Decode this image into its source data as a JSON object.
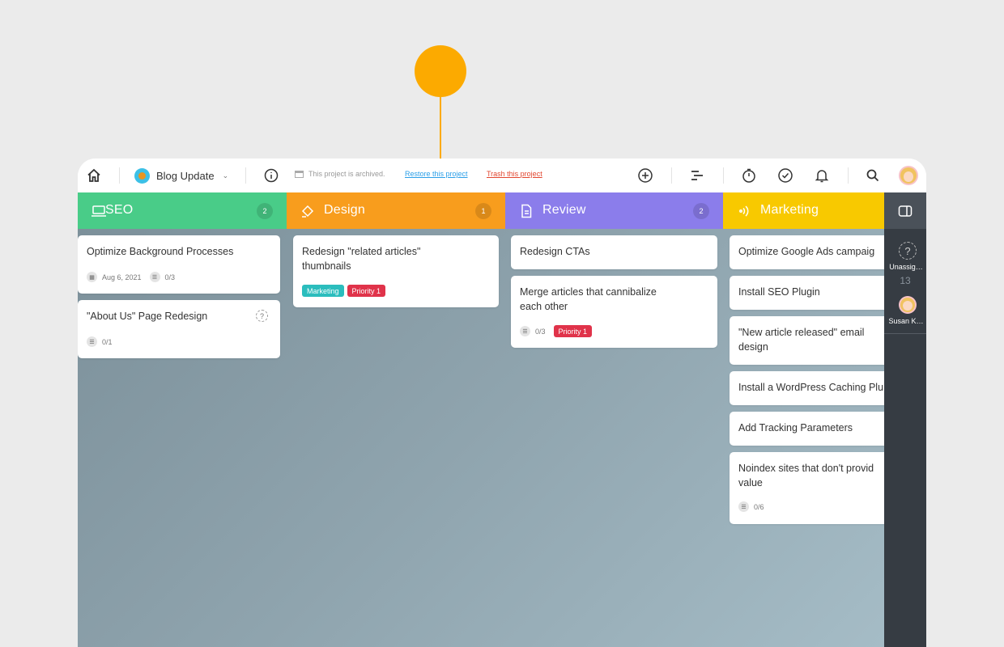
{
  "topbar": {
    "project_name": "Blog Update",
    "archived_text": "This project is archived.",
    "restore_link": "Restore this project",
    "trash_link": "Trash this project",
    "icons": [
      "home-icon",
      "info-icon",
      "add-icon",
      "gantt-icon",
      "timer-icon",
      "check-icon",
      "bell-icon",
      "search-icon"
    ]
  },
  "columns": [
    {
      "title": "SEO",
      "count": "2",
      "color": "#49cc88",
      "icon": "laptop-icon",
      "cards": [
        {
          "title": "Optimize Background Processes",
          "date": "Aug 6, 2021",
          "subtasks": "0/3"
        },
        {
          "title": "\"About Us\" Page Redesign",
          "subtasks": "0/1"
        }
      ]
    },
    {
      "title": "Design",
      "count": "1",
      "color": "#f89d1d",
      "icon": "paint-bucket-icon",
      "cards": [
        {
          "title_line1": "Redesign \"related articles\"",
          "title_line2": "thumbnails",
          "tags": [
            "Marketing",
            "Priority 1"
          ]
        }
      ]
    },
    {
      "title": "Review",
      "count": "2",
      "color": "#8b7deb",
      "icon": "document-icon",
      "cards": [
        {
          "title": "Redesign CTAs"
        },
        {
          "title_line1": "Merge articles that cannibalize",
          "title_line2": "each other",
          "subtasks": "0/3",
          "tags": [
            "Priority 1"
          ]
        }
      ]
    },
    {
      "title": "Marketing",
      "color": "#f8c900",
      "icon": "broadcast-icon",
      "cards": [
        {
          "title": "Optimize Google Ads campaig"
        },
        {
          "title": "Install SEO Plugin"
        },
        {
          "title_line1": "\"New article released\" email",
          "title_line2": "design"
        },
        {
          "title": "Install a WordPress Caching Plu"
        },
        {
          "title": "Add Tracking Parameters"
        },
        {
          "title_line1": "Noindex sites that don't provid",
          "title_line2": "value",
          "subtasks": "0/6"
        }
      ]
    }
  ],
  "tag_colors": {
    "Marketing": "#2bbdbd",
    "Priority 1": "#e0334a"
  },
  "right_panel": {
    "unassigned_label": "Unassig…",
    "unassigned_count": "13",
    "user_label": "Susan K…"
  }
}
